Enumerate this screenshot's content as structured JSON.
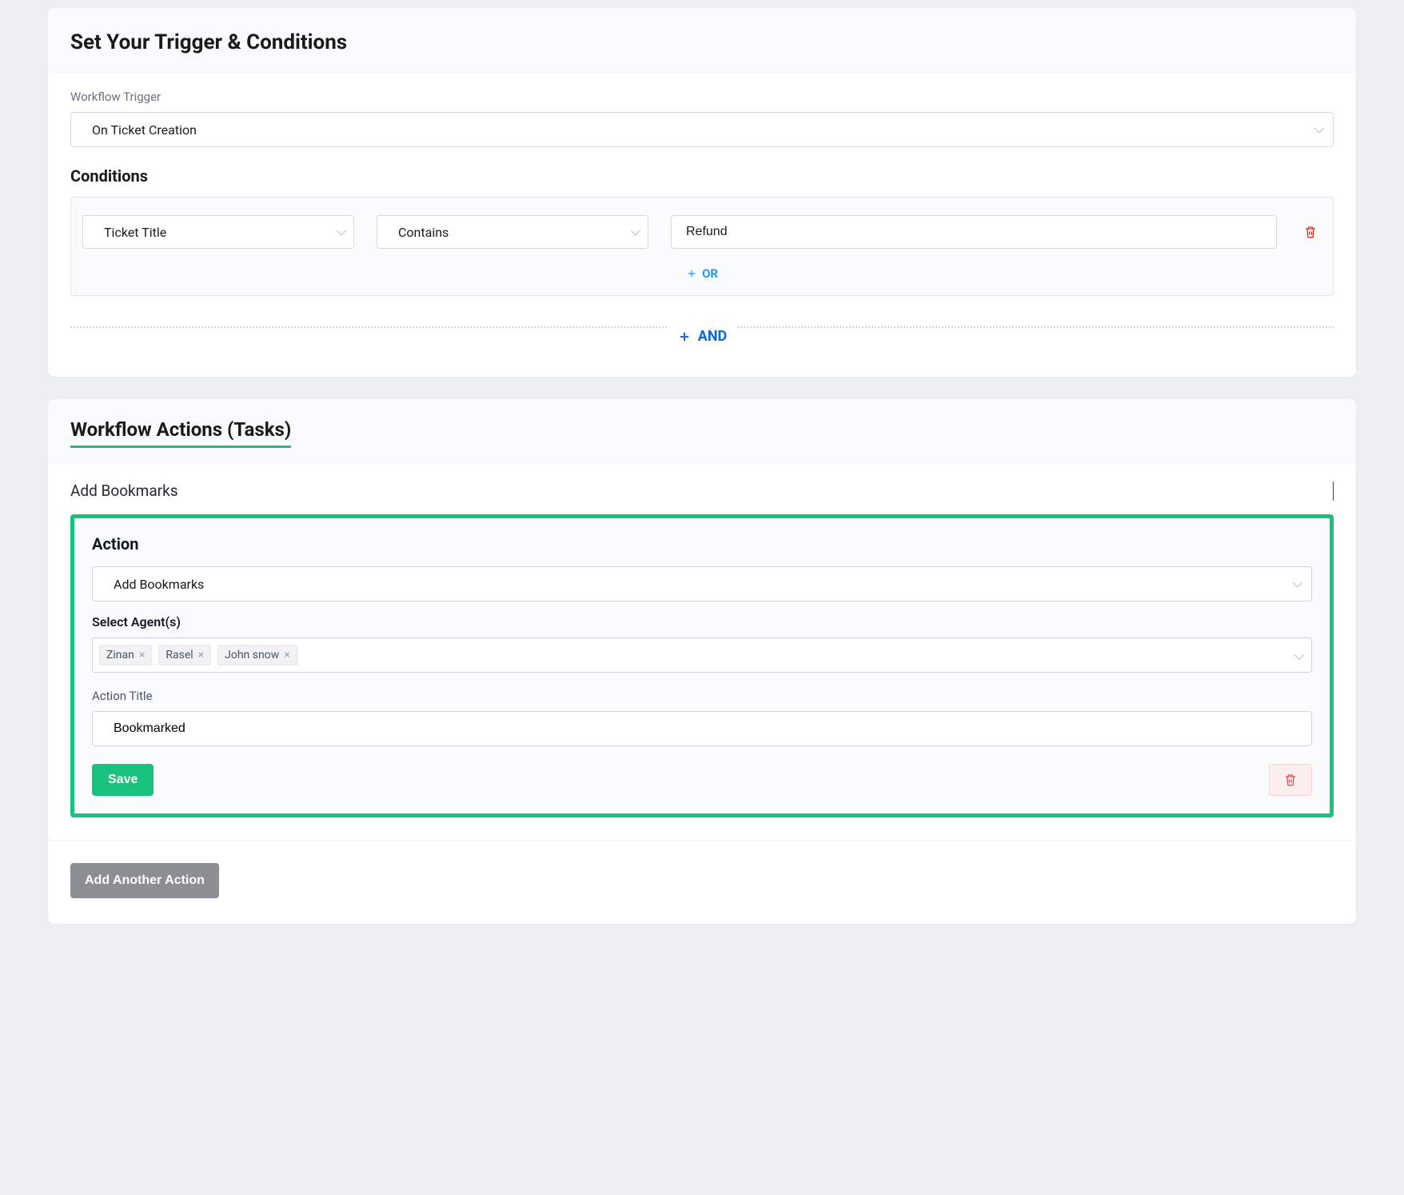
{
  "trigger_card": {
    "title": "Set Your Trigger & Conditions",
    "trigger_label": "Workflow Trigger",
    "trigger_value": "On Ticket Creation",
    "conditions_label": "Conditions",
    "condition": {
      "field": "Ticket Title",
      "operator": "Contains",
      "value": "Refund"
    },
    "or_label": "OR",
    "and_label": "AND"
  },
  "actions_card": {
    "title": "Workflow Actions (Tasks)",
    "collapse_label": "Add Bookmarks",
    "panel": {
      "heading": "Action",
      "action_value": "Add Bookmarks",
      "agents_label": "Select Agent(s)",
      "agents": [
        "Zinan",
        "Rasel",
        "John snow"
      ],
      "title_label": "Action Title",
      "title_value": "Bookmarked",
      "save_label": "Save"
    },
    "add_another_label": "Add Another Action"
  }
}
